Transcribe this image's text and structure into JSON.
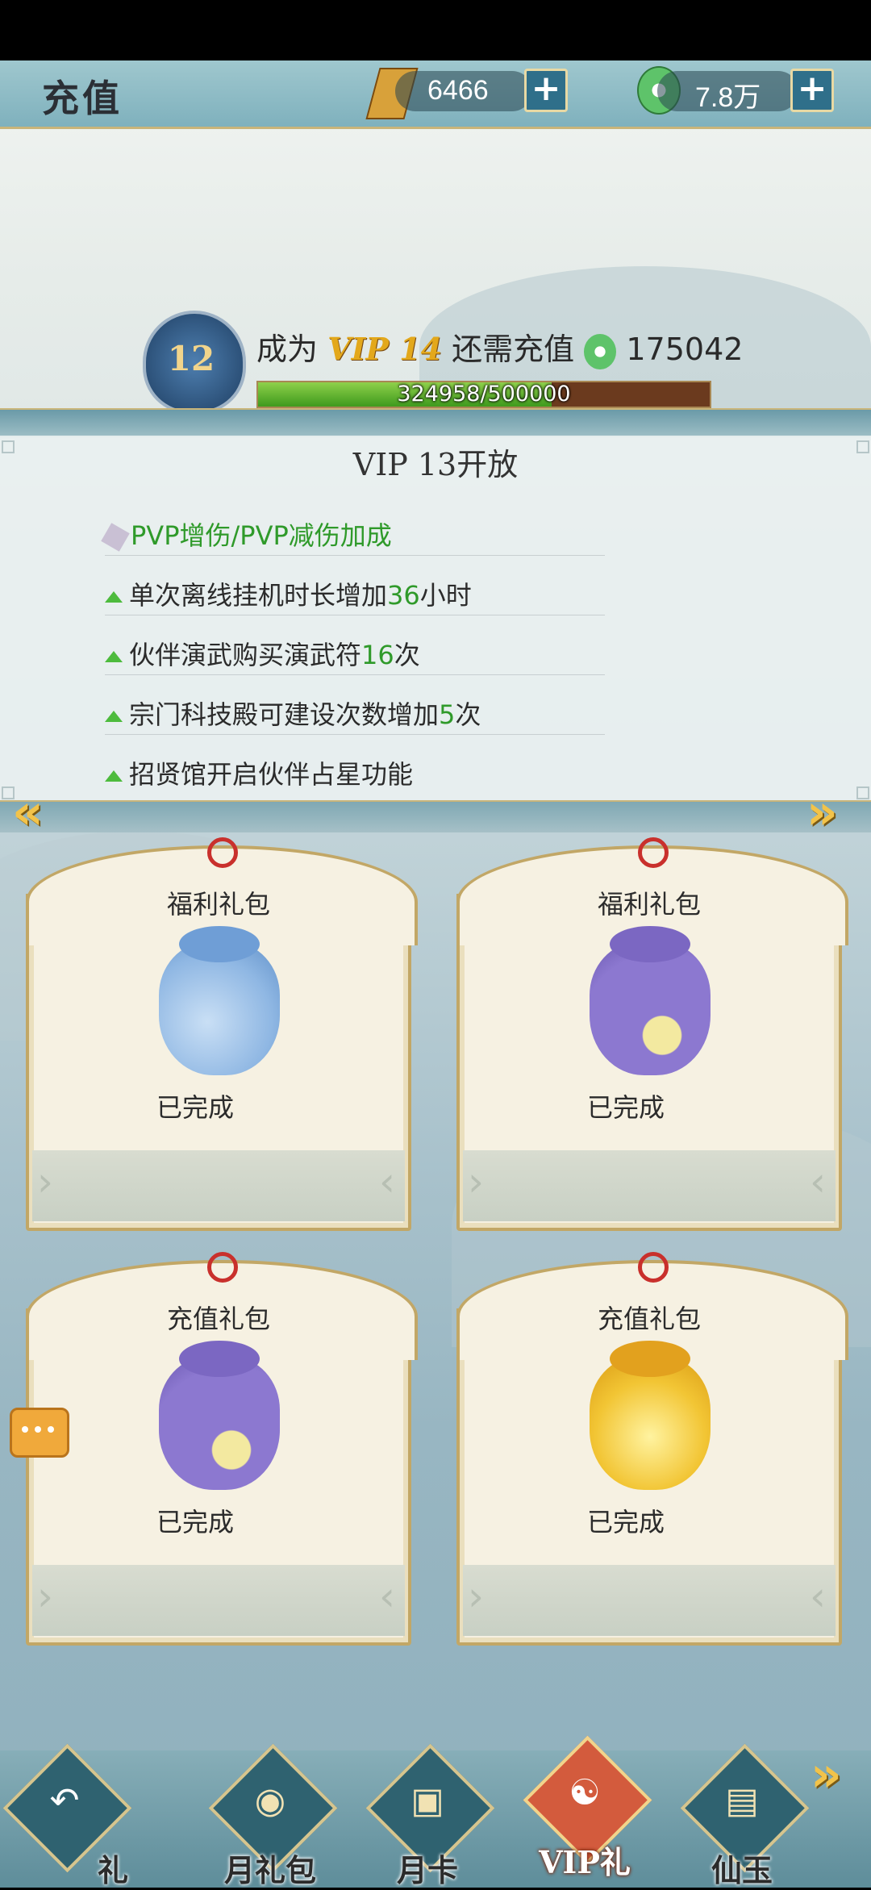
{
  "header": {
    "title": "充值",
    "currency1": {
      "value": "6466",
      "icon": "gold-ticket-icon"
    },
    "currency2": {
      "value": "7.8万",
      "icon": "jade-icon"
    }
  },
  "vip": {
    "level": "12",
    "prefix": "成为",
    "target": "VIP 14",
    "middle": "还需充值",
    "needed": "175042",
    "progress_text": "324958/500000",
    "progress_fraction": 0.65
  },
  "panel": {
    "title": "VIP 13开放",
    "perks": [
      {
        "pre": "PVP增伤/PVP减伤加成",
        "num": "",
        "post": ""
      },
      {
        "pre": "单次离线挂机时长增加",
        "num": "36",
        "post": "小时"
      },
      {
        "pre": "伙伴演武购买演武符",
        "num": "16",
        "post": "次"
      },
      {
        "pre": "宗门科技殿可建设次数增加",
        "num": "5",
        "post": "次"
      },
      {
        "pre": "招贤馆开启伙伴占星功能",
        "num": "",
        "post": ""
      }
    ]
  },
  "cards": [
    {
      "title": "福利礼包",
      "status": "已完成",
      "color": "#8fb7e3"
    },
    {
      "title": "福利礼包",
      "status": "已完成",
      "color": "#8c78d0"
    },
    {
      "title": "充值礼包",
      "status": "已完成",
      "color": "#8c78d0"
    },
    {
      "title": "充值礼包",
      "status": "已完成",
      "color": "#f2c534"
    }
  ],
  "nav": [
    {
      "label": "礼",
      "icon": "back-arrow-icon"
    },
    {
      "label": "月礼包",
      "icon": "money-bag-icon"
    },
    {
      "label": "月卡",
      "icon": "card-icon"
    },
    {
      "label": "VIP礼",
      "icon": "yin-yang-icon"
    },
    {
      "label": "仙玉",
      "icon": "treasure-chest-icon"
    }
  ],
  "colors": {
    "accent": "#d35b3d",
    "gold": "#e3a81b",
    "green": "#2f9a2a"
  }
}
